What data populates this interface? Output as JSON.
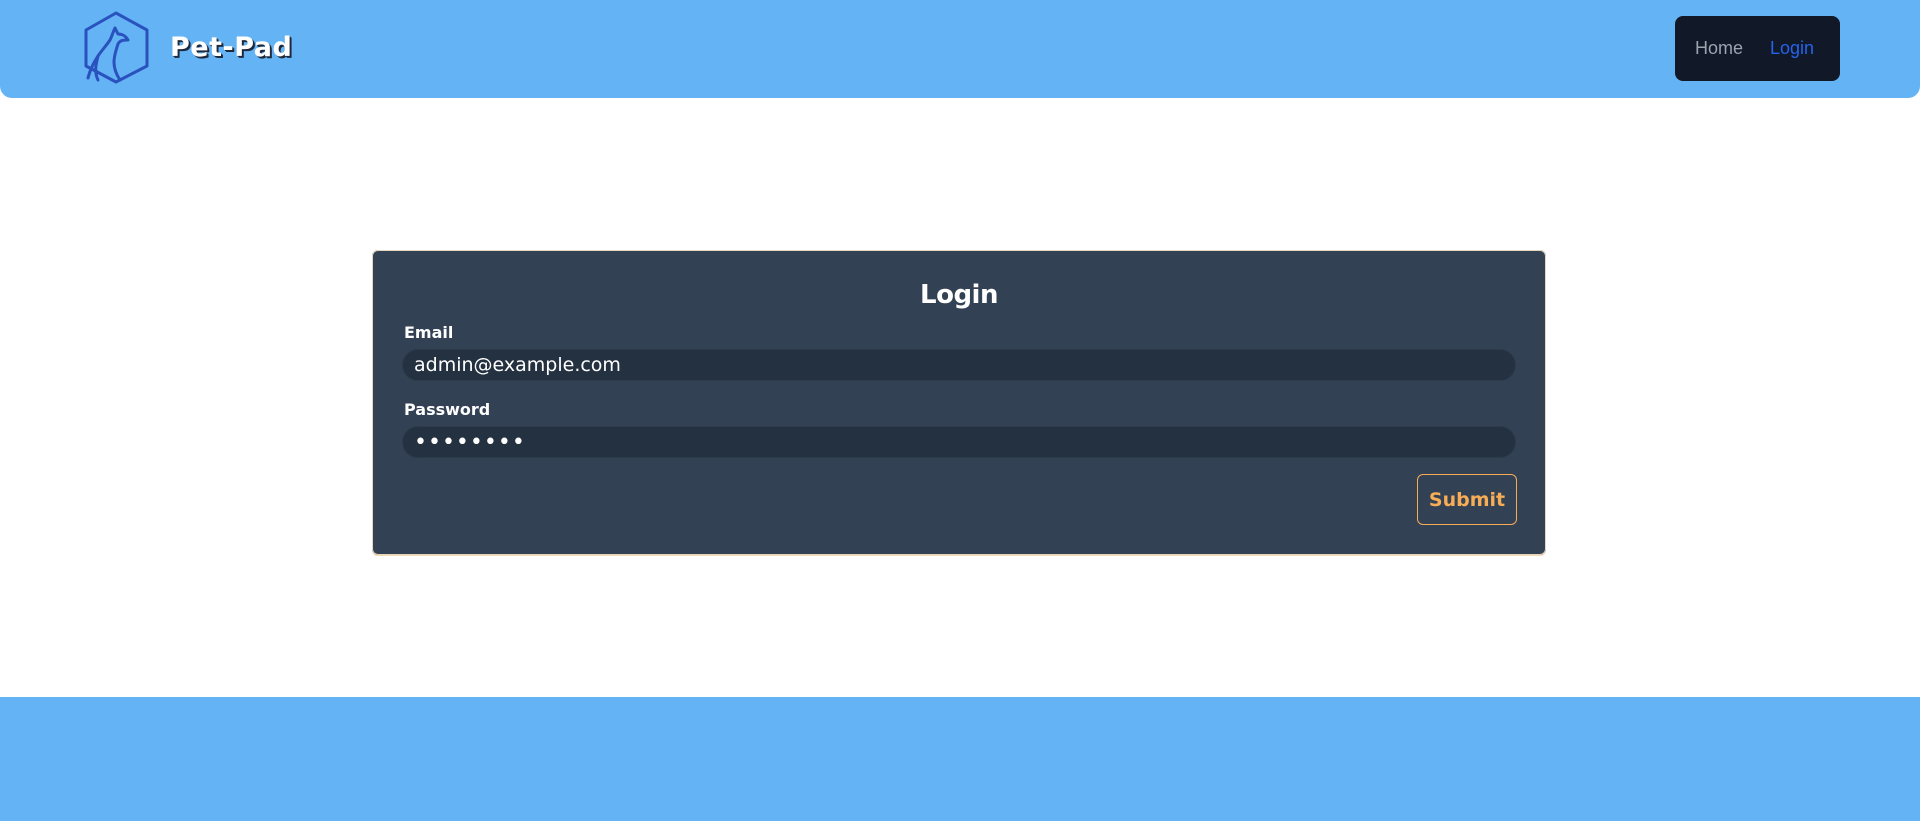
{
  "header": {
    "brand_name": "Pet-Pad",
    "logo_icon": "pet-hexagon-logo-icon",
    "nav": {
      "home_label": "Home",
      "login_label": "Login"
    }
  },
  "login_form": {
    "title": "Login",
    "email_label": "Email",
    "email_value": "admin@example.com",
    "password_label": "Password",
    "password_value": "••••••••",
    "submit_label": "Submit"
  },
  "colors": {
    "header_bg": "#63b3f5",
    "nav_bg": "#111827",
    "nav_active": "#2563eb",
    "card_bg": "#334155",
    "input_bg": "#243140",
    "accent": "#f6ad55"
  }
}
